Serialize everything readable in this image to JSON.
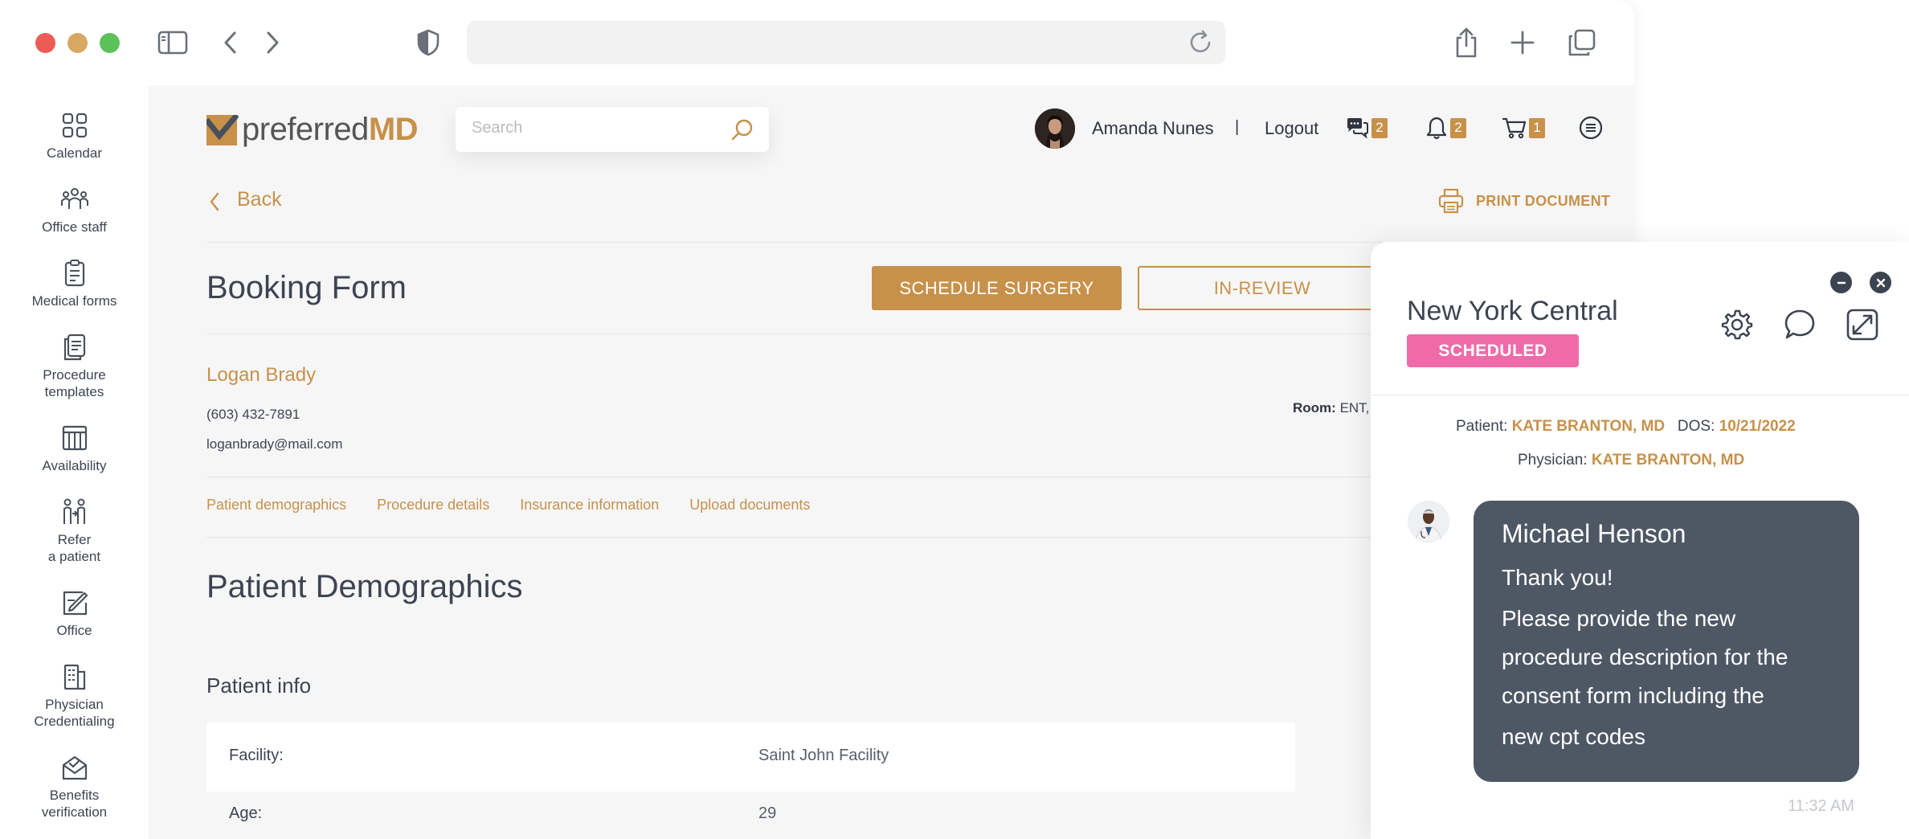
{
  "browser": {
    "url": ""
  },
  "sidebar": {
    "items": [
      {
        "label": "Calendar",
        "icon": "calendar-grid-icon"
      },
      {
        "label": "Office staff",
        "icon": "office-staff-icon"
      },
      {
        "label": "Medical forms",
        "icon": "medical-forms-icon"
      },
      {
        "label": "Procedure\ntemplates",
        "icon": "procedure-templates-icon"
      },
      {
        "label": "Availability",
        "icon": "availability-icon"
      },
      {
        "label": "Refer\na patient",
        "icon": "refer-patient-icon"
      },
      {
        "label": "Office",
        "icon": "office-icon"
      },
      {
        "label": "Physician\nCredentialing",
        "icon": "physician-credentialing-icon"
      },
      {
        "label": "Benefits\nverification",
        "icon": "benefits-verification-icon"
      }
    ]
  },
  "header": {
    "logo_prefix": "preferred",
    "logo_suffix": "MD",
    "search_placeholder": "Search",
    "user_name": "Amanda Nunes",
    "separator": "|",
    "logout_label": "Logout",
    "messages_count": "2",
    "notifications_count": "2",
    "cart_count": "1"
  },
  "page": {
    "back_label": "Back",
    "print_label": "PRINT DOCUMENT",
    "title": "Booking Form",
    "schedule_label": "SCHEDULE SURGERY",
    "review_label": "IN-REVIEW",
    "patient_name": "Logan Brady",
    "patient_phone": "(603) 432-7891",
    "patient_email": "loganbrady@mail.com",
    "room_label": "Room:",
    "room_value": "ENT,",
    "tabs": [
      "Patient demographics",
      "Procedure details",
      "Insurance information",
      "Upload documents"
    ],
    "section_title": "Patient Demographics",
    "subsection_title": "Patient info",
    "info": [
      {
        "label": "Facility:",
        "value": "Saint John Facility"
      },
      {
        "label": "Age:",
        "value": "29"
      }
    ]
  },
  "chat": {
    "title": "New York Central",
    "status": "SCHEDULED",
    "patient_label": "Patient:",
    "patient_value": "KATE BRANTON, MD",
    "dos_label": "DOS:",
    "dos_value": "10/21/2022",
    "physician_label": "Physician:",
    "physician_value": "KATE BRANTON, MD",
    "message": {
      "sender": "Michael Henson",
      "lines": [
        "Thank you!",
        "Please provide the new",
        "procedure description for the",
        "consent form including the",
        "new cpt codes"
      ],
      "time": "11:32 AM"
    }
  },
  "colors": {
    "accent": "#c7914a",
    "status_pink": "#ee6ba8",
    "bubble": "#4e5865",
    "text": "#3d4451"
  }
}
